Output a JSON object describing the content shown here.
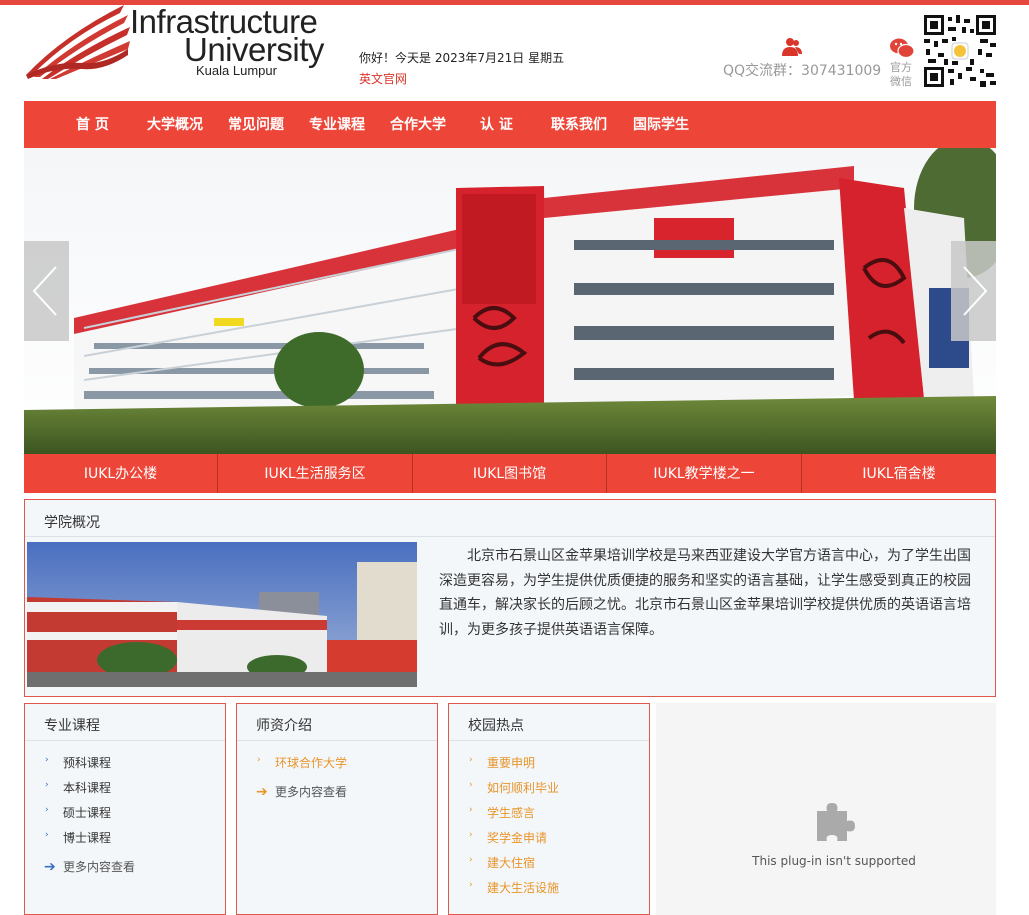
{
  "header": {
    "logo_line1": "Infrastructure",
    "logo_line2": "University",
    "logo_line3": "Kuala Lumpur",
    "greeting": "你好！今天是 2023年7月21日 星期五",
    "english_site_link": "英文官网",
    "qq_group": "QQ交流群：307431009",
    "wechat_label": "官方微信"
  },
  "nav": {
    "items": [
      "首 页",
      "大学概况",
      "常见问题",
      "专业课程",
      "合作大学",
      "认 证",
      "联系我们",
      "国际学生"
    ]
  },
  "banner": {
    "tabs": [
      "IUKL办公楼",
      "IUKL生活服务区",
      "IUKL图书馆",
      "IUKL教学楼之一",
      "IUKL宿舍楼"
    ]
  },
  "about": {
    "title": "学院概况",
    "text": "北京市石景山区金苹果培训学校是马来西亚建设大学官方语言中心，为了学生出国深造更容易，为学生提供优质便捷的服务和坚实的语言基础，让学生感受到真正的校园直通车，解决家长的后顾之忧。北京市石景山区金苹果培训学校提供优质的英语语言培训，为更多孩子提供英语语言保障。"
  },
  "courses": {
    "title": "专业课程",
    "items": [
      "预科课程",
      "本科课程",
      "硕士课程",
      "博士课程"
    ],
    "more": "更多内容查看"
  },
  "teachers": {
    "title": "师资介绍",
    "items": [
      "环球合作大学"
    ],
    "more": "更多内容查看"
  },
  "campus": {
    "title": "校园热点",
    "items": [
      "重要申明",
      "如何顺利毕业",
      "学生感言",
      "奖学金申请",
      "建大住宿",
      "建大生活设施"
    ]
  },
  "plugin": {
    "message": "This plug-in isn't supported"
  },
  "colors": {
    "brand_red": "#ed4639",
    "link_orange": "#e8952a",
    "panel_bg": "#f3f7fa"
  }
}
